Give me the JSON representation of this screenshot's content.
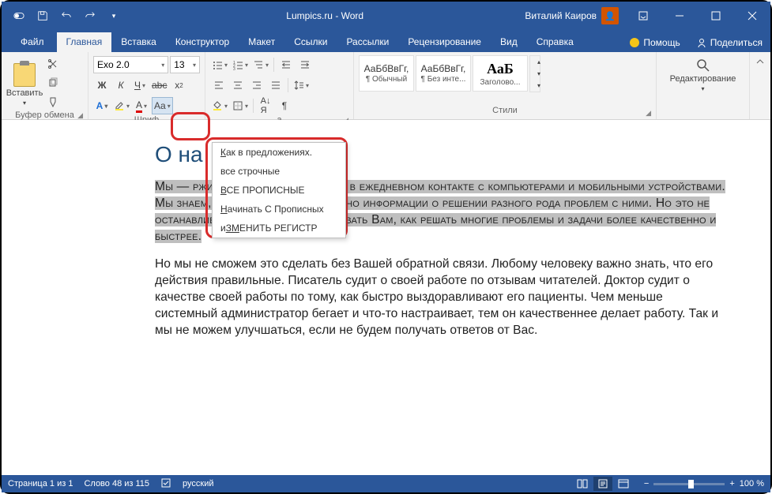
{
  "titlebar": {
    "title": "Lumpics.ru - Word",
    "user": "Виталий Каиров"
  },
  "tabs": {
    "file": "Файл",
    "home": "Главная",
    "insert": "Вставка",
    "design": "Конструктор",
    "layout": "Макет",
    "references": "Ссылки",
    "mailings": "Рассылки",
    "review": "Рецензирование",
    "view": "Вид",
    "help": "Справка",
    "assist": "Помощь",
    "share": "Поделиться"
  },
  "ribbon": {
    "clipboard": {
      "paste": "Вставить",
      "label": "Буфер обмена"
    },
    "font": {
      "name": "Exo 2.0",
      "size": "13",
      "case_btn": "Aa",
      "label": "Шриф"
    },
    "paragraph": {
      "label": "а"
    },
    "styles": {
      "item1_sample": "АаБбВвГг,",
      "item1_name": "¶ Обычный",
      "item2_sample": "АаБбВвГг,",
      "item2_name": "¶ Без инте...",
      "item3_sample": "АаБ",
      "item3_name": "Заголово...",
      "label": "Стили"
    },
    "editing": {
      "label": "Редактирование"
    }
  },
  "case_menu": {
    "i1_pre": "К",
    "i1_rest": "ак в предложениях.",
    "i2": "все строчные",
    "i3_pre": "В",
    "i3_rest": "СЕ ПРОПИСНЫЕ",
    "i4_pre": "Н",
    "i4_rest": "ачинать С Прописных",
    "i5_pre": "и",
    "i5_mid": "ЗМ",
    "i5_rest": "ЕНИТЬ РЕГИСТР"
  },
  "document": {
    "heading": "О на",
    "p1": "Мы —                                               ржимых идеей помогать Вам в ежедневном контакте с компьютерами и мобильными устройствами. Мы знаем, что в интернете уже полно информации о решении разного рода проблем с ними. Но это не останавливает нас, чтобы рассказывать Вам, как решать многие проблемы и задачи более качественно и быстрее.",
    "p2": "Но мы не сможем это сделать без Вашей обратной связи. Любому человеку важно знать, что его действия правильные. Писатель судит о своей работе по отзывам читателей. Доктор судит о качестве своей работы по тому, как быстро выздоравливают его пациенты. Чем меньше системный администратор бегает и что-то настраивает, тем он качественнее делает работу. Так и мы не можем улучшаться, если не будем получать ответов от Вас."
  },
  "status": {
    "page": "Страница 1 из 1",
    "words": "Слово 48 из 115",
    "lang": "русский",
    "zoom": "100 %"
  }
}
